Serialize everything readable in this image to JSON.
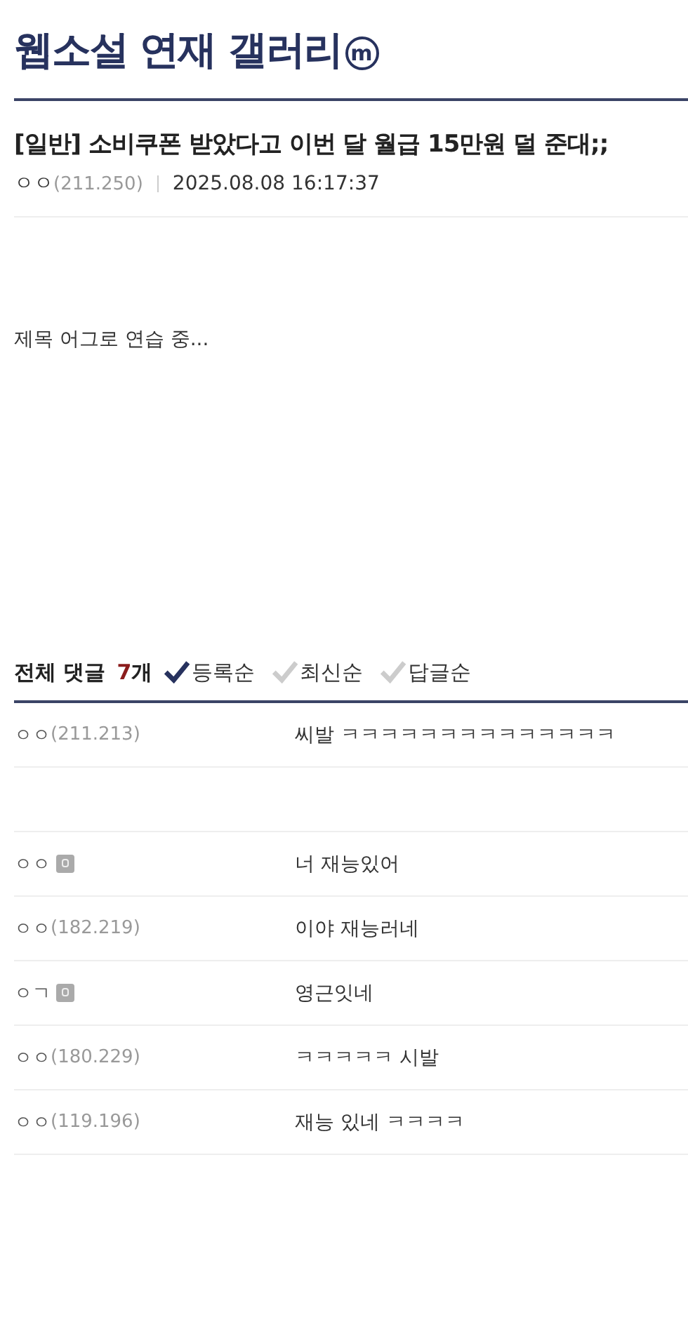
{
  "gallery": {
    "title": "웹소설 연재 갤러리",
    "badge": "m"
  },
  "post": {
    "title": "[일반] 소비쿠폰 받았다고 이번 달 월급 15만원 덜 준대;;",
    "author": "ㅇㅇ",
    "ip": "(211.250)",
    "date": "2025.08.08 16:17:37",
    "body": "제목 어그로 연습 중..."
  },
  "comments_header": {
    "label": "전체 댓글",
    "count": "7",
    "unit": "개",
    "sort_options": [
      {
        "label": "등록순",
        "selected": true
      },
      {
        "label": "최신순",
        "selected": false
      },
      {
        "label": "답글순",
        "selected": false
      }
    ]
  },
  "comments": [
    {
      "kind": "guest",
      "author": "ㅇㅇ",
      "ip": "(211.213)",
      "text": "씨발 ㅋㅋㅋㅋㅋㅋㅋㅋㅋㅋㅋㅋㅋㅋ"
    },
    {
      "kind": "removed"
    },
    {
      "kind": "member",
      "author": "ㅇㅇ",
      "text": "너 재능있어"
    },
    {
      "kind": "guest",
      "author": "ㅇㅇ",
      "ip": "(182.219)",
      "text": "이야 재능러네"
    },
    {
      "kind": "member",
      "author": "ㅇㄱ",
      "text": "영근잇네"
    },
    {
      "kind": "guest",
      "author": "ㅇㅇ",
      "ip": "(180.229)",
      "text": "ㅋㅋㅋㅋㅋ 시발"
    },
    {
      "kind": "guest",
      "author": "ㅇㅇ",
      "ip": "(119.196)",
      "text": "재능 있네 ㅋㅋㅋㅋ"
    }
  ]
}
